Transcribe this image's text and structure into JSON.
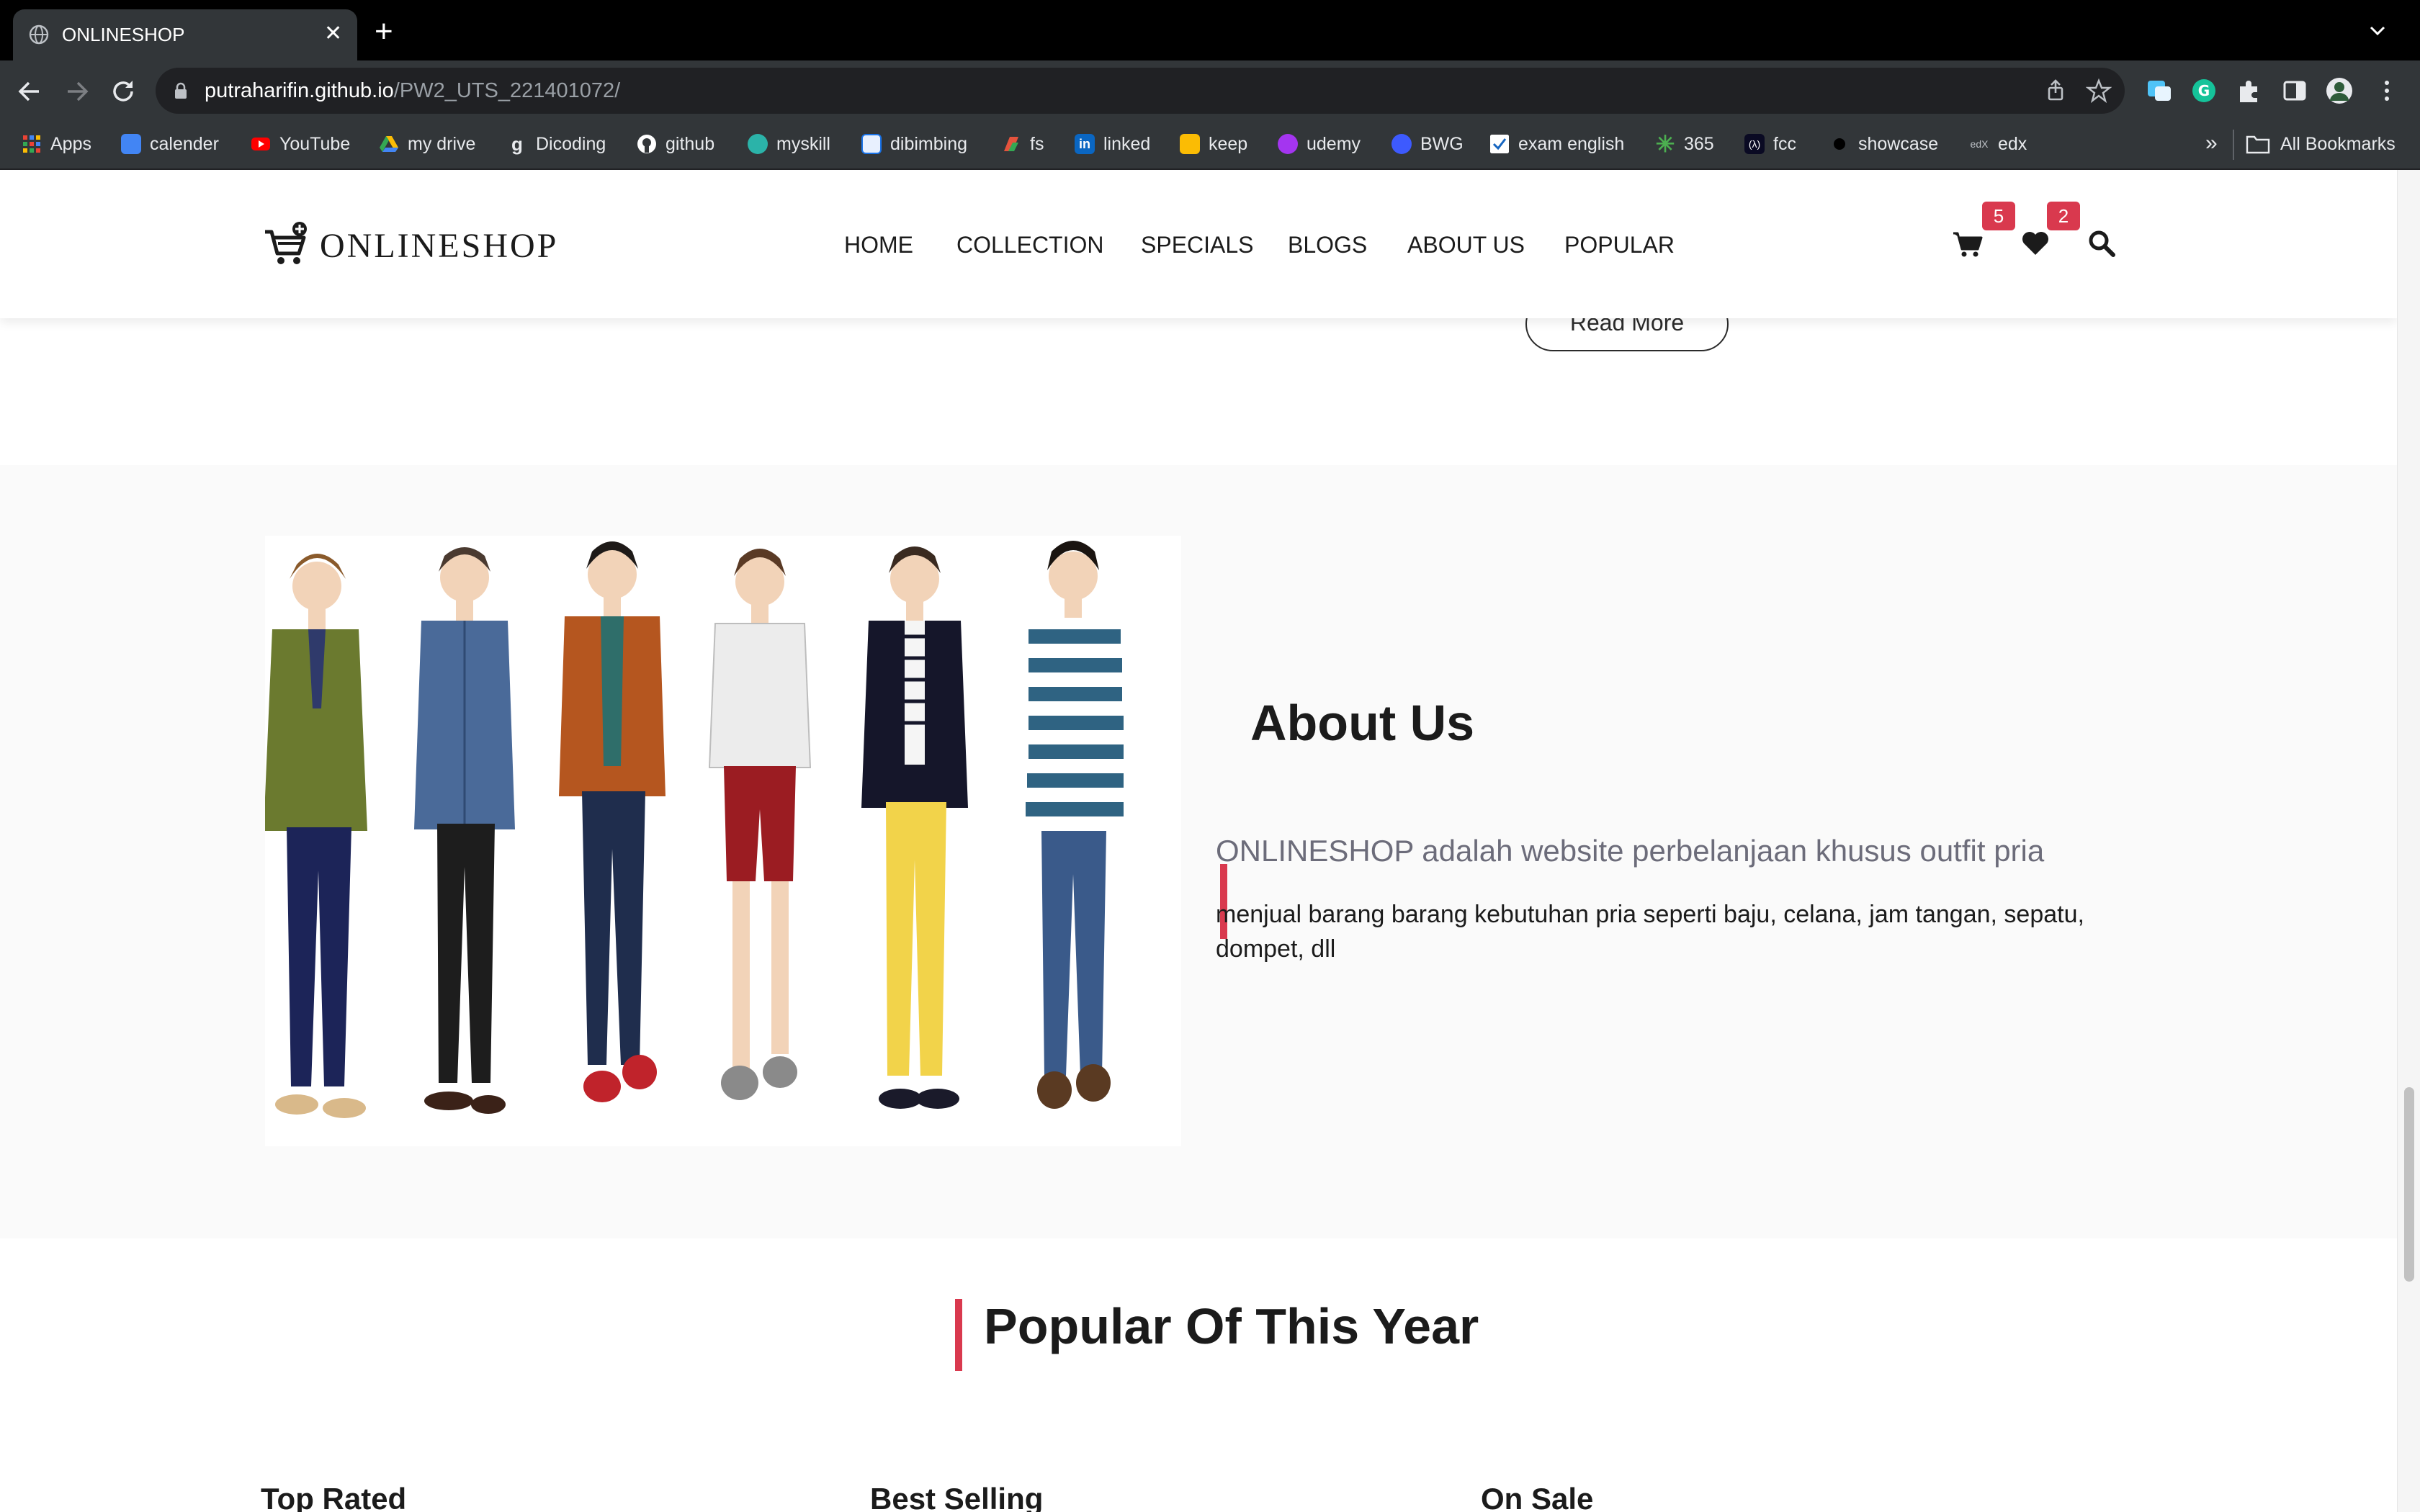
{
  "browser": {
    "tab_title": "ONLINESHOP",
    "url_host": "putraharifin.github.io",
    "url_path": "/PW2_UTS_221401072/",
    "bookmarks": [
      {
        "label": "Apps",
        "color": "#ea4335"
      },
      {
        "label": "calender",
        "color": "#4285f4"
      },
      {
        "label": "YouTube",
        "color": "#ff0000"
      },
      {
        "label": "my drive",
        "color": "#34a853"
      },
      {
        "label": "Dicoding",
        "color": "#2d3e50"
      },
      {
        "label": "github",
        "color": "#ffffff"
      },
      {
        "label": "myskill",
        "color": "#2bb3a9"
      },
      {
        "label": "dibimbing",
        "color": "#1a73e8"
      },
      {
        "label": "fs",
        "color": "#e5533d"
      },
      {
        "label": "linked",
        "color": "#0a66c2"
      },
      {
        "label": "keep",
        "color": "#fbbc04"
      },
      {
        "label": "udemy",
        "color": "#a435f0"
      },
      {
        "label": "BWG",
        "color": "#3d5afe"
      },
      {
        "label": "exam english",
        "color": "#ffffff"
      },
      {
        "label": "365",
        "color": "#4caf50"
      },
      {
        "label": "fcc",
        "color": "#0a0a23"
      },
      {
        "label": "showcase",
        "color": "#000000"
      },
      {
        "label": "edx",
        "color": "#02262b"
      }
    ],
    "more_label": "»",
    "all_bookmarks": "All Bookmarks"
  },
  "site": {
    "logo": "ONLINESHOP",
    "nav": [
      "HOME",
      "COLLECTION",
      "SPECIALS",
      "BLOGS",
      "ABOUT US",
      "POPULAR"
    ],
    "cart_count": "5",
    "wishlist_count": "2",
    "accent_color": "#d9394e"
  },
  "read_more": "Read More",
  "about": {
    "title": "About Us",
    "lead": "ONLINESHOP adalah website perbelanjaan khusus outfit pria",
    "description": "menjual barang barang kebutuhan pria seperti baju, celana, jam tangan, sepatu, dompet, dll"
  },
  "popular": {
    "title": "Popular Of This Year",
    "columns": [
      "Top Rated",
      "Best Selling",
      "On Sale"
    ]
  }
}
